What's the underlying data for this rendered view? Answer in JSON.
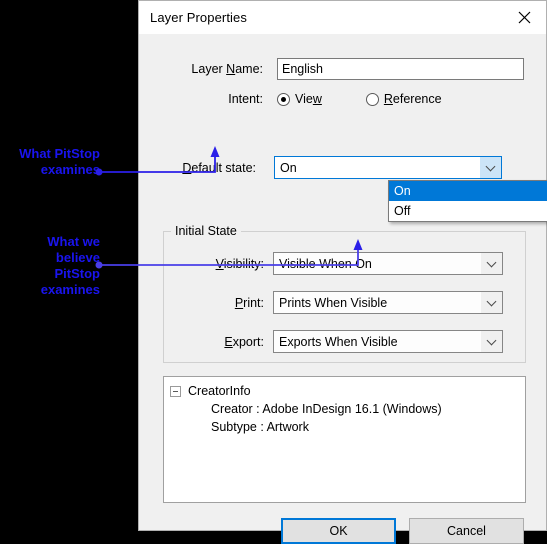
{
  "window": {
    "title": "Layer Properties",
    "close_icon": "close-icon"
  },
  "form": {
    "layer_name": {
      "label_pre": "Layer ",
      "label_acc": "N",
      "label_post": "ame:",
      "value": "English"
    },
    "intent": {
      "label": "Intent:",
      "options": [
        {
          "label_pre": "Vie",
          "label_acc": "w",
          "label_post": "",
          "checked": true
        },
        {
          "label_pre": "",
          "label_acc": "R",
          "label_post": "eference",
          "checked": false
        }
      ]
    },
    "default_state": {
      "label_acc": "D",
      "label_post": "efault state:",
      "value": "On",
      "expanded": true,
      "options": [
        {
          "label": "On",
          "selected": true
        },
        {
          "label": "Off",
          "selected": false
        }
      ]
    }
  },
  "initial_state": {
    "group_title": "Initial State",
    "visibility": {
      "label_acc": "V",
      "label_post": "isibility:",
      "value": "Visible When On"
    },
    "print": {
      "label_acc": "P",
      "label_post": "rint:",
      "value": "Prints When Visible"
    },
    "export": {
      "label_acc": "E",
      "label_post": "xport:",
      "value": "Exports When Visible"
    }
  },
  "creator_info": {
    "root_label": "CreatorInfo",
    "expander_icon": "minus-box-icon",
    "children": [
      "Creator : Adobe InDesign 16.1 (Windows)",
      "Subtype : Artwork"
    ]
  },
  "footer": {
    "ok_label": "OK",
    "cancel_label": "Cancel"
  },
  "annotations": {
    "color": "#1a14ef",
    "items": [
      {
        "text": "What PitStop\nexamines"
      },
      {
        "text": "What we\nbelieve\nPitStop\nexamines"
      }
    ]
  }
}
